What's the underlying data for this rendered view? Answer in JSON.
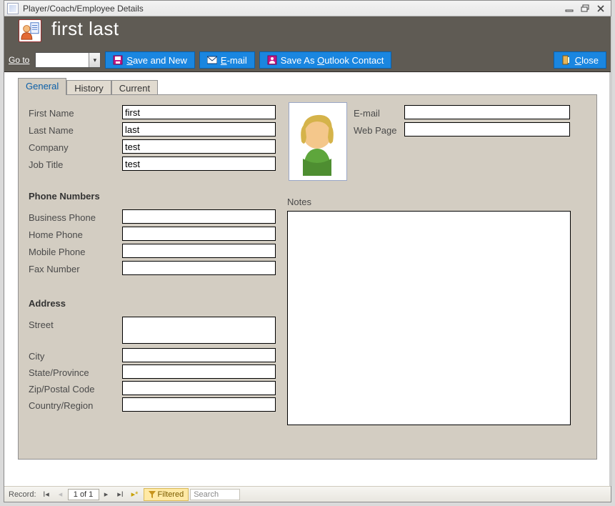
{
  "window": {
    "title": "Player/Coach/Employee Details"
  },
  "header": {
    "title": "first last",
    "goto_label": "Go to"
  },
  "toolbar": {
    "save_label": "ave and New",
    "email_label": "-mail",
    "outlook_label": "utlook Contact",
    "outlook_prefix": "Save As ",
    "close_label": "lose"
  },
  "tabs": {
    "general": "General",
    "history": "History",
    "current": "Current"
  },
  "labels": {
    "first_name": "First Name",
    "last_name": "Last Name",
    "company": "Company",
    "job_title": "Job Title",
    "phone_h": "Phone Numbers",
    "business": "Business Phone",
    "home": "Home Phone",
    "mobile": "Mobile Phone",
    "fax": "Fax Number",
    "address_h": "Address",
    "street": "Street",
    "city": "City",
    "state": "State/Province",
    "zip": "Zip/Postal Code",
    "country": "Country/Region",
    "email": "E-mail",
    "web": "Web Page",
    "notes": "Notes"
  },
  "values": {
    "first_name": "first",
    "last_name": "last",
    "company": "test",
    "job_title": "test",
    "business": "",
    "home": "",
    "mobile": "",
    "fax": "",
    "street": "",
    "city": "",
    "state": "",
    "zip": "",
    "country": "",
    "email": "",
    "web": "",
    "notes": ""
  },
  "nav": {
    "record_label": "Record:",
    "record_text": "1 of 1",
    "filtered": "Filtered",
    "search_placeholder": "Search"
  }
}
